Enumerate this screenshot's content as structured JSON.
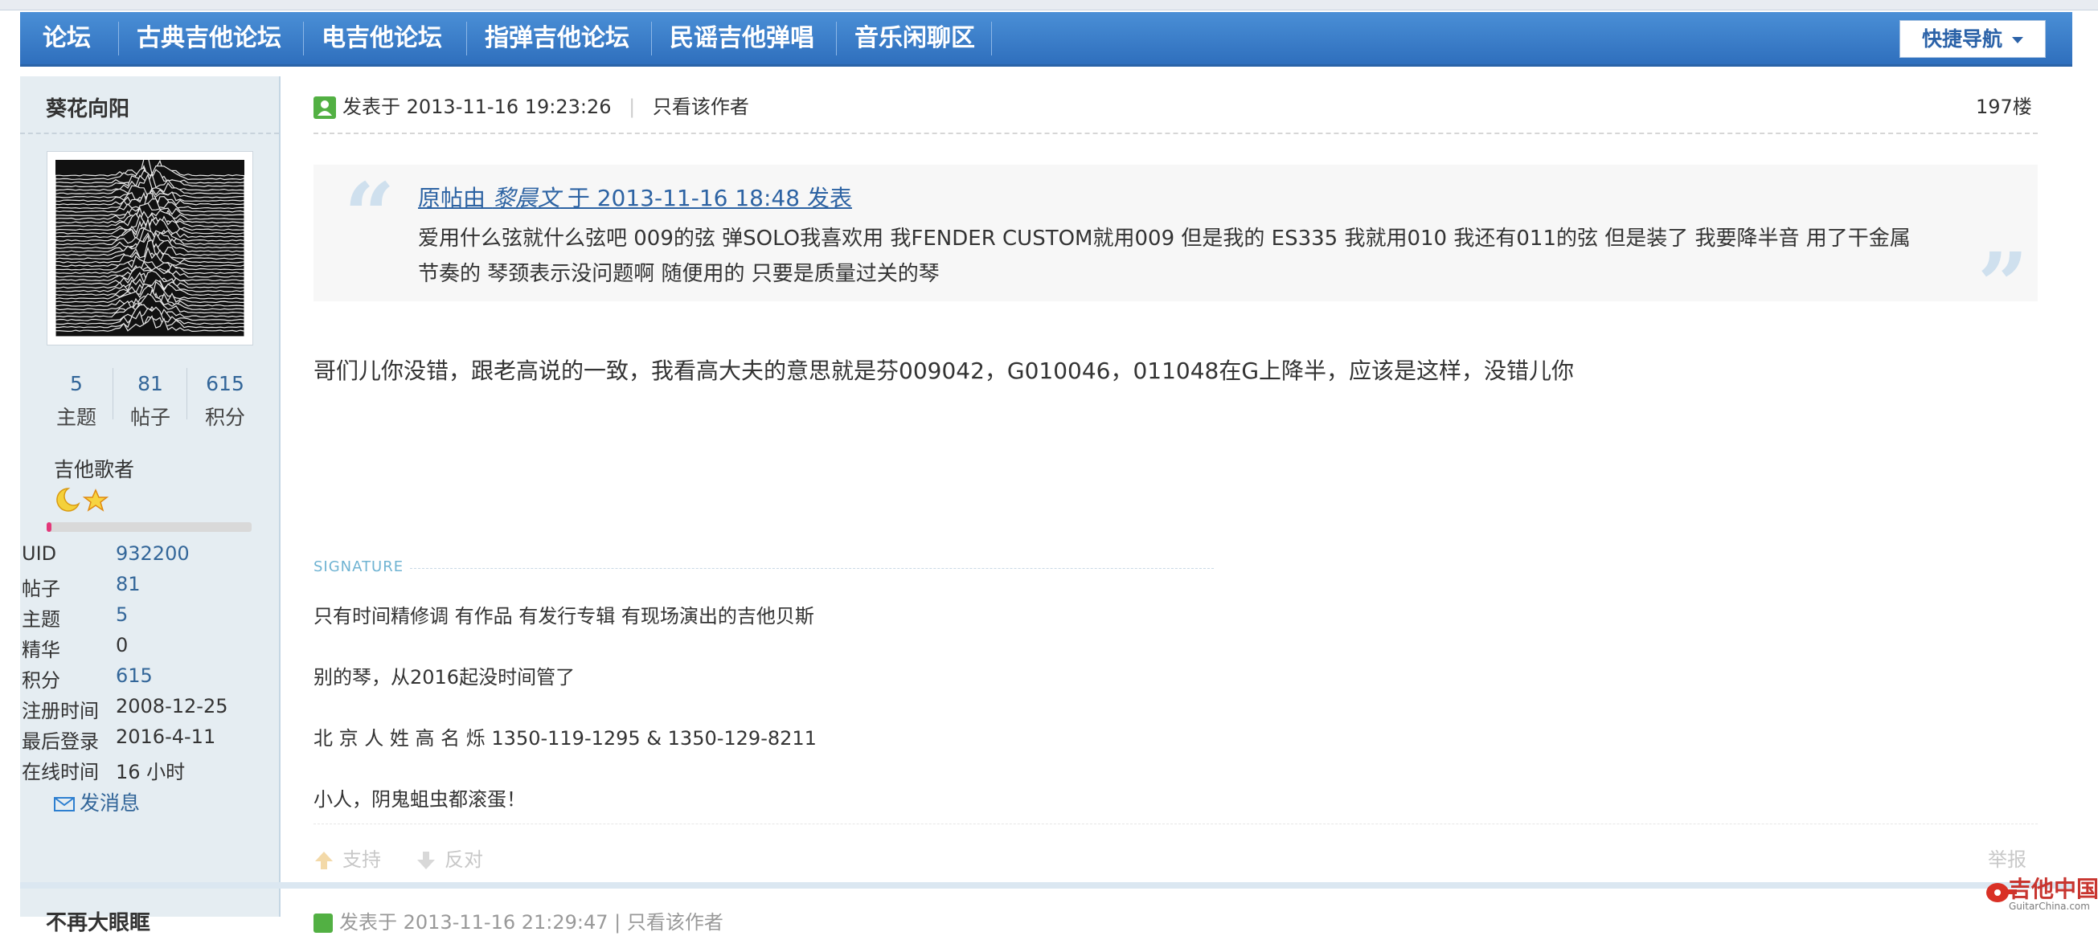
{
  "nav": {
    "items": [
      "论坛",
      "古典吉他论坛",
      "电吉他论坛",
      "指弹吉他论坛",
      "民谣吉他弹唱",
      "音乐闲聊区"
    ],
    "quick_nav": "快捷导航"
  },
  "author": {
    "name": "葵花向阳",
    "stats": [
      {
        "value": "5",
        "label": "主题"
      },
      {
        "value": "81",
        "label": "帖子"
      },
      {
        "value": "615",
        "label": "积分"
      }
    ],
    "rank": "吉他歌者",
    "level_progress": 0.02,
    "info": [
      {
        "label": "UID",
        "value": "932200"
      },
      {
        "label": "帖子",
        "value": "81"
      },
      {
        "label": "主题",
        "value": "5"
      },
      {
        "label": "精华",
        "value": "0"
      },
      {
        "label": "积分",
        "value": "615"
      },
      {
        "label": "注册时间",
        "value": "2008-12-25"
      },
      {
        "label": "最后登录",
        "value": "2016-4-11"
      },
      {
        "label": "在线时间",
        "value": "16 小时"
      }
    ],
    "send_message": "发消息"
  },
  "post": {
    "posted_at": "发表于 2013-11-16 19:23:26",
    "only_author": "只看该作者",
    "floor": "197楼",
    "quote": {
      "prefix": "原帖由 ",
      "author": "黎晨文",
      "suffix": " 于 2013-11-16 18:48 发表",
      "body": "爱用什么弦就什么弦吧 009的弦 弹SOLO我喜欢用 我FENDER CUSTOM就用009   但是我的 ES335 我就用010   我还有011的弦 但是装了 我要降半音 用了干金属节奏的   琴颈表示没问题啊 随便用的 只要是质量过关的琴"
    },
    "body": "哥们儿你没错，跟老高说的一致，我看高大夫的意思就是芬009042，G010046，011048在G上降半，应该是这样，没错儿你",
    "signature_label": "SIGNATURE",
    "signature": [
      "只有时间精修调   有作品   有发行专辑   有现场演出的吉他贝斯",
      "别的琴，从2016起没时间管了",
      "北 京 人 姓 高 名 烁    1350-119-1295  &  1350-129-8211",
      "小人，阴鬼蛆虫都滚蛋！"
    ],
    "support": "支持",
    "oppose": "反对",
    "report": "举报"
  },
  "next_post": {
    "name": "不再大眼眶",
    "posted_at": "发表于 2013-11-16 21:29:47   |   只看该作者"
  },
  "watermark": {
    "title": "吉他中国",
    "url": "GuitarChina.com"
  },
  "colors": {
    "nav": "#3a7fcc",
    "link": "#336699",
    "sidebar": "#e5edf2"
  }
}
